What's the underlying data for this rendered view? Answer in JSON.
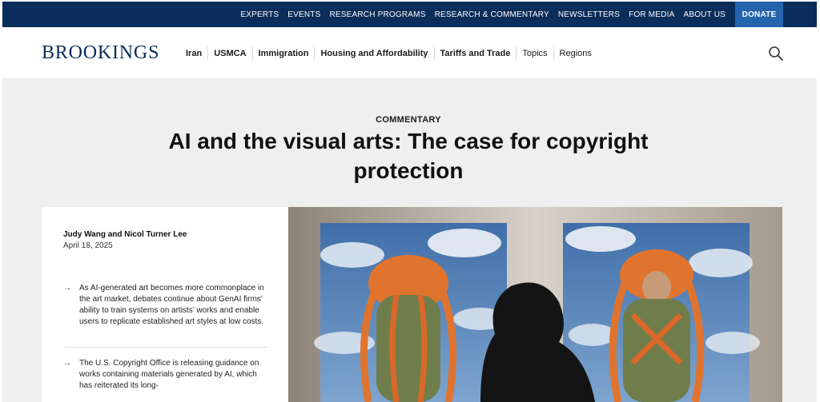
{
  "topbar": {
    "links": [
      "EXPERTS",
      "EVENTS",
      "RESEARCH PROGRAMS",
      "RESEARCH & COMMENTARY",
      "NEWSLETTERS",
      "FOR MEDIA",
      "ABOUT US"
    ],
    "donate": "DONATE"
  },
  "brand": {
    "logo": "BROOKINGS",
    "color": "#0b2d5b"
  },
  "nav": {
    "items": [
      "Iran",
      "USMCA",
      "Immigration",
      "Housing and Affordability",
      "Tariffs and Trade",
      "Topics",
      "Regions"
    ],
    "search_icon": "search-icon"
  },
  "article": {
    "eyebrow": "COMMENTARY",
    "title": "AI and the visual arts: The case for copyright protection",
    "authors": "Judy Wang and Nicol Turner Lee",
    "date": "April 18, 2025",
    "bullets": [
      "As AI-generated art becomes more commonplace in the art market, debates continue about GenAI firms’ ability to train systems on artists’ works and enable users to replicate established art styles at low costs.",
      "The U.S. Copyright Office is releasing guidance on works containing materials generated by AI, which has reiterated its long-"
    ],
    "arrow": "→"
  }
}
